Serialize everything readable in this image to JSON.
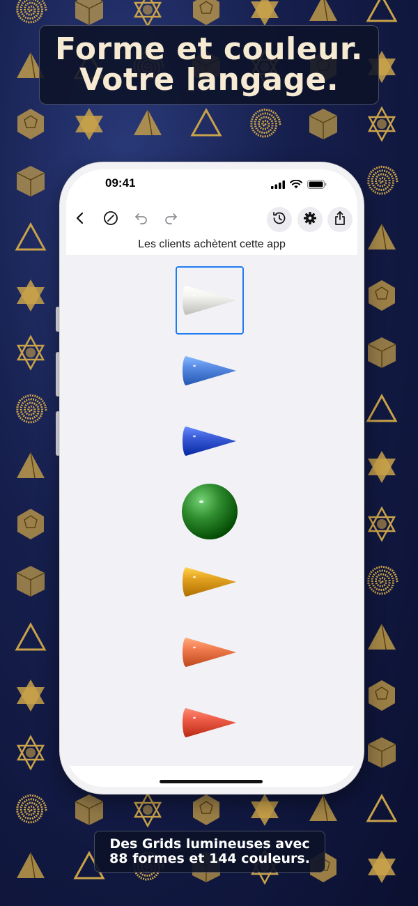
{
  "headline": {
    "line1": "Forme et couleur.",
    "line2": "Votre langage."
  },
  "caption": {
    "line1": "Des Grids lumineuses avec",
    "line2": "88 formes et 144 couleurs."
  },
  "colors": {
    "background_top": "#2a3a7a",
    "background_bottom": "#0b1030",
    "gold": "#c9a24a",
    "headline_text": "#f6ead2",
    "selection": "#1f7bf2",
    "canvas": "#f2f2f6"
  },
  "background_pattern_icons": [
    "spiral-icon",
    "star-of-david-icon",
    "cube-icon",
    "pyramid-icon",
    "merkaba-icon",
    "triangle-outline-icon",
    "dodecahedron-icon"
  ],
  "phone": {
    "status_bar": {
      "time": "09:41",
      "icons": [
        "cellular-signal-icon",
        "wifi-icon",
        "battery-icon"
      ]
    },
    "toolbar": {
      "left_icons": [
        "back-chevron-icon",
        "clear-circle-slash-icon",
        "undo-icon",
        "redo-icon"
      ],
      "right_icons": [
        "history-icon",
        "settings-gear-icon",
        "share-icon"
      ]
    },
    "title": "Les clients achètent cette app",
    "shapes": [
      {
        "type": "cone",
        "color": "#f4f4f0",
        "selected": true
      },
      {
        "type": "cone",
        "color": "#5b8ee6",
        "selected": false
      },
      {
        "type": "cone",
        "color": "#3d5fd9",
        "selected": false
      },
      {
        "type": "sphere",
        "color": "#2e8c2e",
        "selected": false
      },
      {
        "type": "cone",
        "color": "#e6a623",
        "selected": false
      },
      {
        "type": "cone",
        "color": "#f47f52",
        "selected": false
      },
      {
        "type": "cone",
        "color": "#f0604a",
        "selected": false
      }
    ]
  }
}
